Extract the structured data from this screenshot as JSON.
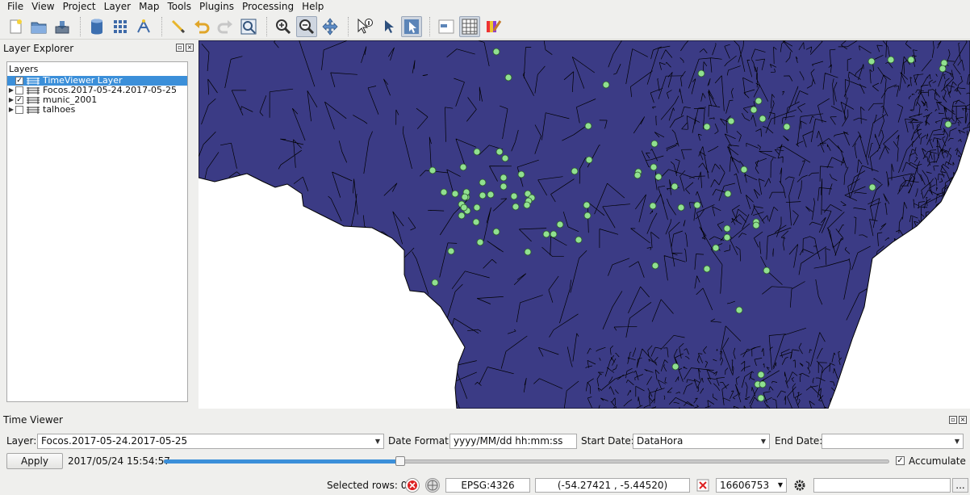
{
  "menubar": {
    "items": [
      {
        "label": "File"
      },
      {
        "label": "View"
      },
      {
        "label": "Project"
      },
      {
        "label": "Layer"
      },
      {
        "label": "Map"
      },
      {
        "label": "Tools"
      },
      {
        "label": "Plugins"
      },
      {
        "label": "Processing"
      },
      {
        "label": "Help"
      }
    ]
  },
  "toolbar": {
    "buttons": [
      "new-document-icon",
      "open-folder-icon",
      "save-icon",
      "database-icon",
      "grid-layer-icon",
      "vector-edit-icon",
      "pencil-icon",
      "undo-icon",
      "redo-icon",
      "zoom-extent-icon",
      "zoom-in-icon",
      "zoom-out-icon",
      "pan-icon",
      "identify-icon",
      "select-pointer-icon",
      "select-feature-icon",
      "attribute-table-icon",
      "table-grid-icon",
      "style-palette-icon"
    ]
  },
  "layer_explorer": {
    "title": "Layer Explorer",
    "header": "Layers",
    "layers": [
      {
        "name": "TimeViewer Layer",
        "checked": true,
        "selected": true,
        "expandable": false
      },
      {
        "name": "Focos.2017-05-24.2017-05-25",
        "checked": false,
        "selected": false,
        "expandable": true
      },
      {
        "name": "munic_2001",
        "checked": true,
        "selected": false,
        "expandable": true
      },
      {
        "name": "talhoes",
        "checked": false,
        "selected": false,
        "expandable": true
      }
    ]
  },
  "map": {
    "fill_color": "#3b3b85",
    "point_color": "#90e090"
  },
  "time_viewer": {
    "title": "Time Viewer",
    "layer_label": "Layer:",
    "layer_value": "Focos.2017-05-24.2017-05-25",
    "date_format_label": "Date Format:",
    "date_format_value": "yyyy/MM/dd hh:mm:ss",
    "start_date_label": "Start Date:",
    "start_date_value": "DataHora",
    "end_date_label": "End Date:",
    "end_date_value": "",
    "apply_label": "Apply",
    "current_time": "2017/05/24 15:54:57",
    "slider_position": 0.325,
    "accumulate_label": "Accumulate",
    "accumulate_checked": true
  },
  "statusbar": {
    "selected_rows": "Selected rows: 0",
    "crs": "EPSG:4326",
    "coordinates": "(-54.27421 , -5.44520)",
    "scale": "16606753",
    "search_value": "",
    "more_label": "..."
  }
}
